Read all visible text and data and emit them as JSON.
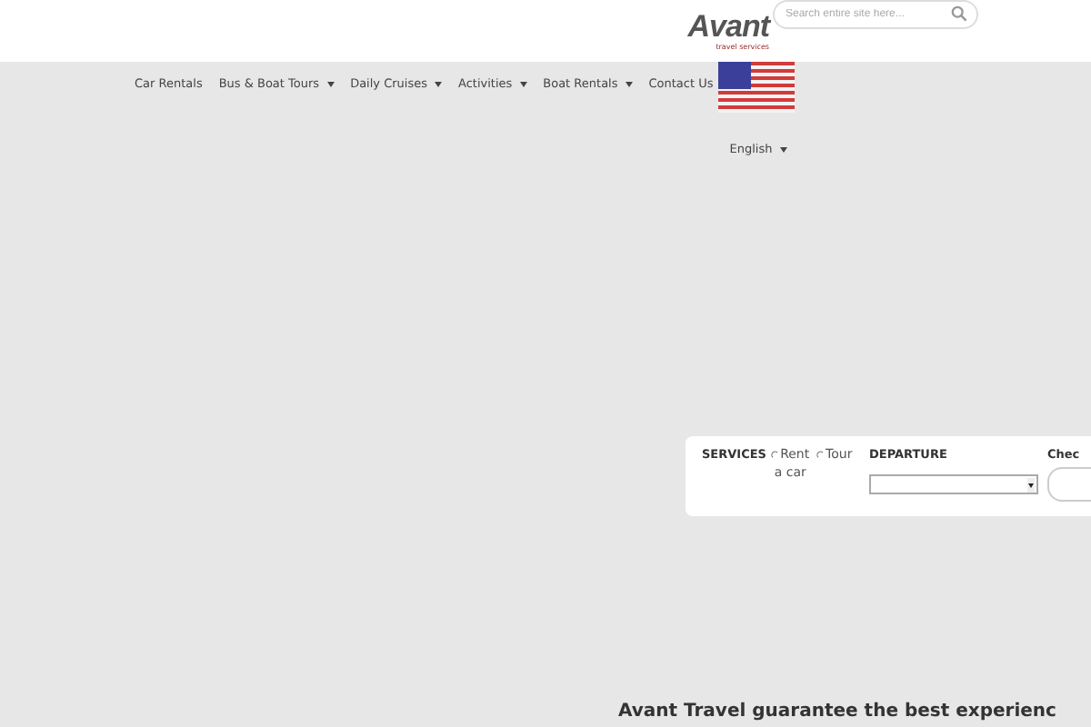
{
  "header": {
    "logo": {
      "name": "Avant",
      "tagline": "travel services"
    },
    "search": {
      "placeholder": "Search entire site here..."
    }
  },
  "nav": [
    {
      "label": "Car Rentals",
      "dropdown": false
    },
    {
      "label": "Bus & Boat Tours",
      "dropdown": true
    },
    {
      "label": "Daily Cruises",
      "dropdown": true
    },
    {
      "label": "Activities",
      "dropdown": true
    },
    {
      "label": "Boat Rentals",
      "dropdown": true
    },
    {
      "label": "Contact Us",
      "dropdown": false
    }
  ],
  "language": {
    "label": "English"
  },
  "booking": {
    "services_label": "SERVICES",
    "services": [
      {
        "label": "Rent a car"
      },
      {
        "label": "Tour"
      }
    ],
    "departure_label": "DEPARTURE",
    "checkin_label": "Chec"
  },
  "tagline": "Avant Travel guarantee the best experienc"
}
